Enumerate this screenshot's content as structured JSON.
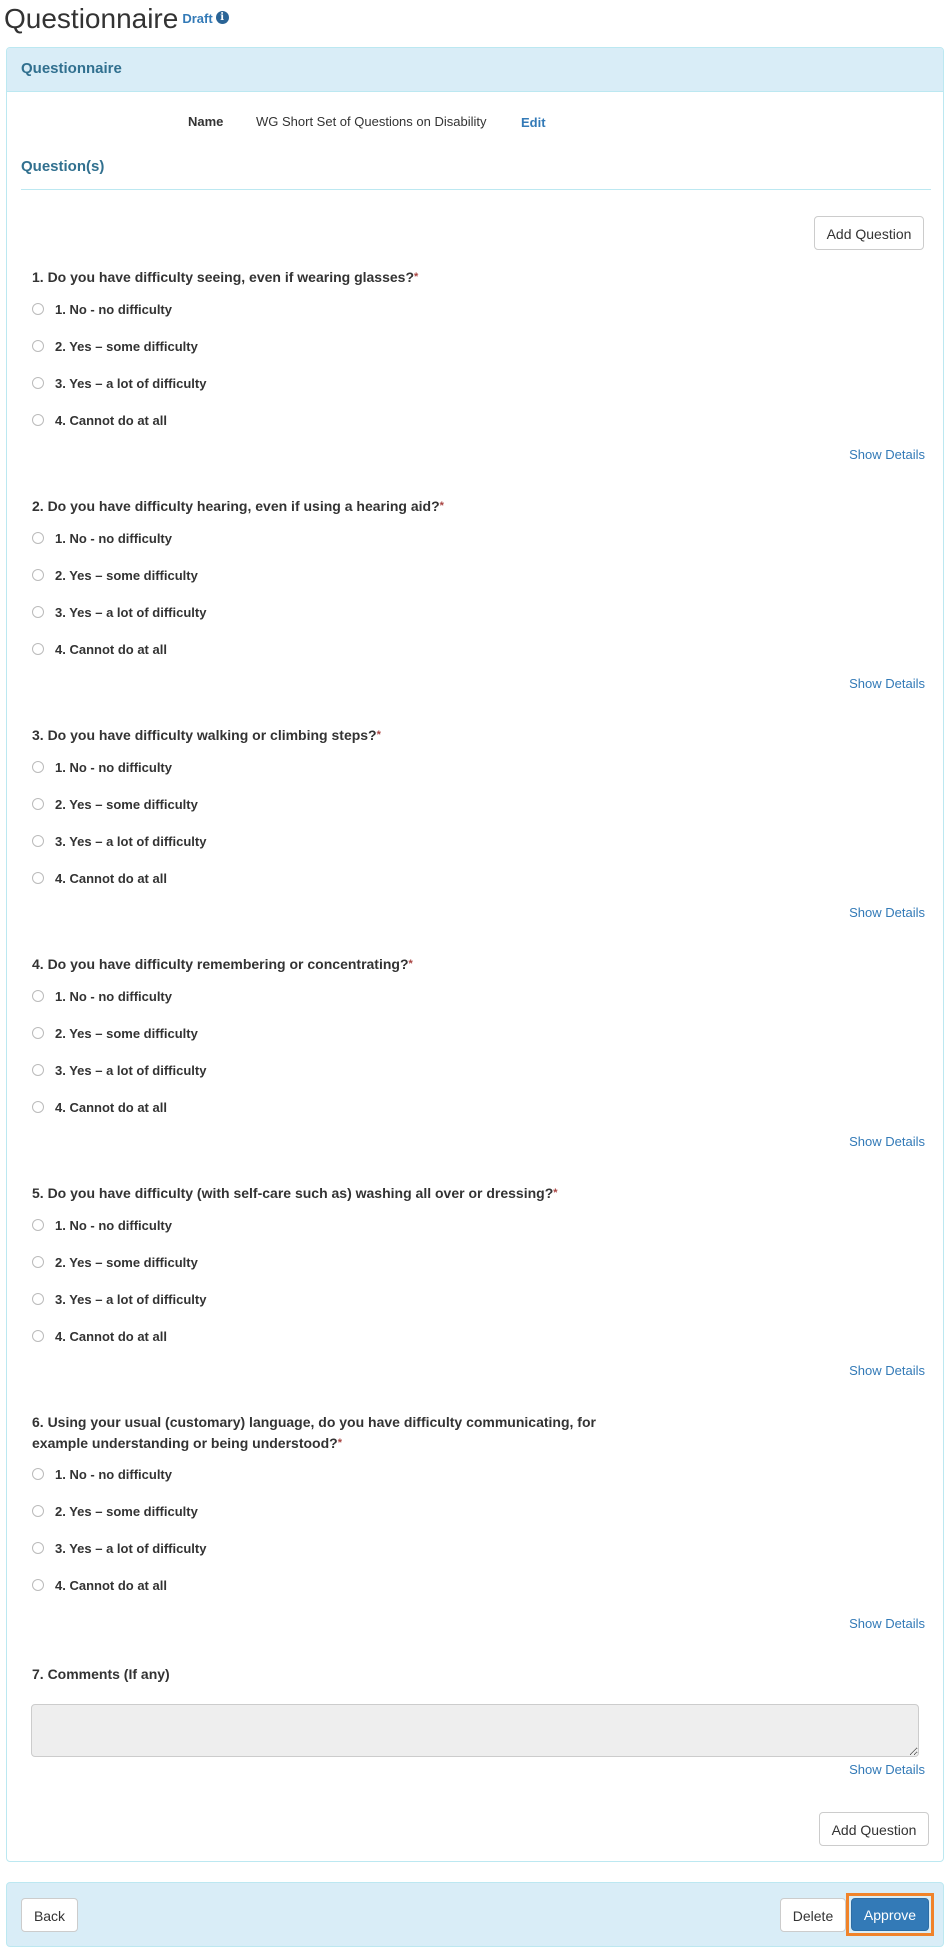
{
  "page": {
    "title": "Questionnaire",
    "status": "Draft",
    "status_icon": "info-circle-icon"
  },
  "panel": {
    "heading": "Questionnaire",
    "name_label": "Name",
    "name_value": "WG Short Set of Questions on Disability",
    "edit_label": "Edit",
    "section_title": "Question(s)",
    "add_question_label": "Add Question"
  },
  "questions": [
    {
      "title": "1. Do you have difficulty seeing, even if wearing glasses?",
      "required": "*",
      "options": [
        "1. No - no difficulty",
        "2. Yes – some difficulty",
        "3. Yes – a lot of difficulty",
        "4. Cannot do at all"
      ],
      "show_details": "Show Details"
    },
    {
      "title": "2. Do you have difficulty hearing, even if using a hearing aid?",
      "required": "*",
      "options": [
        "1. No - no difficulty",
        "2. Yes – some difficulty",
        "3. Yes – a lot of difficulty",
        "4. Cannot do at all"
      ],
      "show_details": "Show Details"
    },
    {
      "title": "3. Do you have difficulty walking or climbing steps?",
      "required": "*",
      "options": [
        "1. No - no difficulty",
        "2. Yes – some difficulty",
        "3. Yes – a lot of difficulty",
        "4. Cannot do at all"
      ],
      "show_details": "Show Details"
    },
    {
      "title": "4. Do you have difficulty remembering or concentrating?",
      "required": "*",
      "options": [
        "1. No - no difficulty",
        "2. Yes – some difficulty",
        "3. Yes – a lot of difficulty",
        "4. Cannot do at all"
      ],
      "show_details": "Show Details"
    },
    {
      "title": "5. Do you have difficulty (with self-care such as) washing all over or dressing?",
      "required": "*",
      "options": [
        "1. No - no difficulty",
        "2. Yes – some difficulty",
        "3. Yes – a lot of difficulty",
        "4. Cannot do at all"
      ],
      "show_details": "Show Details"
    },
    {
      "title_line1": "6. Using your usual (customary) language, do you have difficulty communicating, for",
      "title_line2": "example understanding or being understood?",
      "required": "*",
      "options": [
        "1. No - no difficulty",
        "2. Yes – some difficulty",
        "3. Yes – a lot of difficulty",
        "4. Cannot do at all"
      ],
      "show_details": "Show Details"
    },
    {
      "title": "7. Comments (If any)",
      "comments_value": "",
      "show_details": "Show Details"
    }
  ],
  "footer": {
    "back_label": "Back",
    "delete_label": "Delete",
    "approve_label": "Approve",
    "approve_highlight_color": "#f0832a",
    "approve_color": "#337ab7"
  }
}
